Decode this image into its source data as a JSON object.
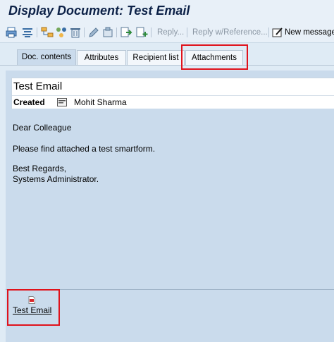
{
  "window": {
    "title": "Display Document: Test Email"
  },
  "toolbar": {
    "reply_label": "Reply...",
    "reply_ref_label": "Reply w/Reference...",
    "new_message_label": "New message"
  },
  "tabs": [
    {
      "label": "Doc. contents",
      "active": true
    },
    {
      "label": "Attributes",
      "active": false
    },
    {
      "label": "Recipient list",
      "active": false
    },
    {
      "label": "Attachments",
      "active": false
    }
  ],
  "document": {
    "subject": "Test Email",
    "created_label": "Created",
    "created_by": "Mohit Sharma",
    "body": [
      "Dear Colleague",
      "Please find attached a test smartform.",
      "Best Regards,",
      "Systems Administrator."
    ]
  },
  "attachments": [
    {
      "name": "Test Email",
      "icon": "pdf-file-icon"
    }
  ],
  "colors": {
    "title_text": "#0c2147",
    "panel_bg": "#cadbec",
    "highlight": "#e0121b"
  }
}
